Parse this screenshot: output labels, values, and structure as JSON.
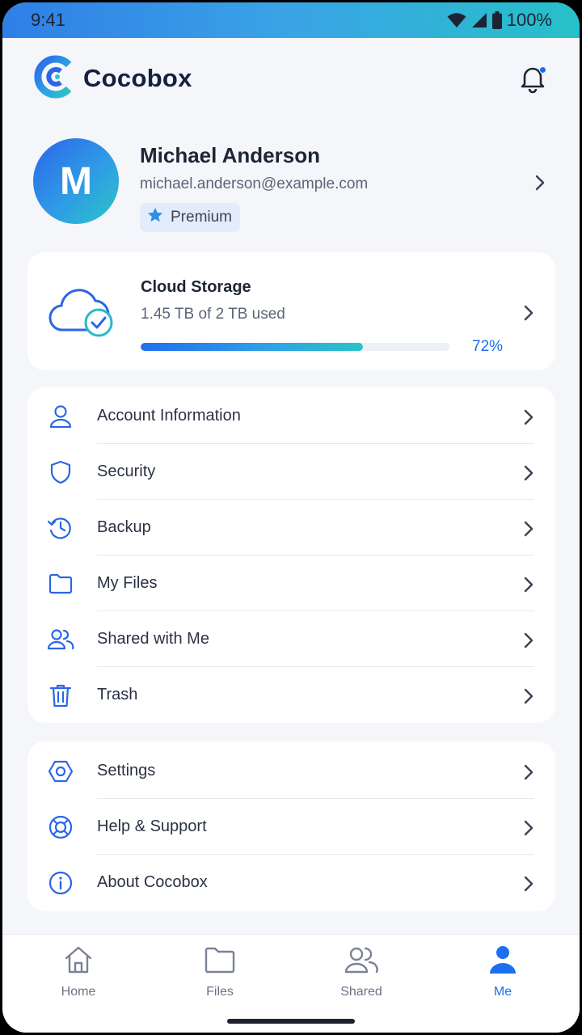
{
  "status": {
    "time": "9:41",
    "battery": "100%"
  },
  "app": {
    "name": "Cocobox"
  },
  "profile": {
    "initial": "M",
    "name": "Michael Anderson",
    "email": "michael.anderson@example.com",
    "plan": "Premium"
  },
  "storage": {
    "title": "Cloud Storage",
    "used_text": "1.45 TB of 2 TB used",
    "percent_label": "72%",
    "percent": 0.72
  },
  "menu_primary": [
    {
      "label": "Account Information",
      "icon": "user-icon"
    },
    {
      "label": "Security",
      "icon": "shield-icon"
    },
    {
      "label": "Backup",
      "icon": "history-icon"
    },
    {
      "label": "My Files",
      "icon": "folder-icon"
    },
    {
      "label": "Shared with Me",
      "icon": "users-icon"
    },
    {
      "label": "Trash",
      "icon": "trash-icon"
    }
  ],
  "menu_secondary": [
    {
      "label": "Settings",
      "icon": "settings-icon"
    },
    {
      "label": "Help & Support",
      "icon": "lifebuoy-icon"
    },
    {
      "label": "About Cocobox",
      "icon": "info-icon"
    }
  ],
  "tabs": [
    {
      "label": "Home",
      "icon": "home-icon"
    },
    {
      "label": "Files",
      "icon": "folder-icon"
    },
    {
      "label": "Shared",
      "icon": "users-icon"
    },
    {
      "label": "Me",
      "icon": "user-icon",
      "active": true
    }
  ],
  "colors": {
    "accent": "#1d6ff0",
    "text": "#1e2535",
    "muted": "#5c6477",
    "teal": "#29c3c6"
  }
}
